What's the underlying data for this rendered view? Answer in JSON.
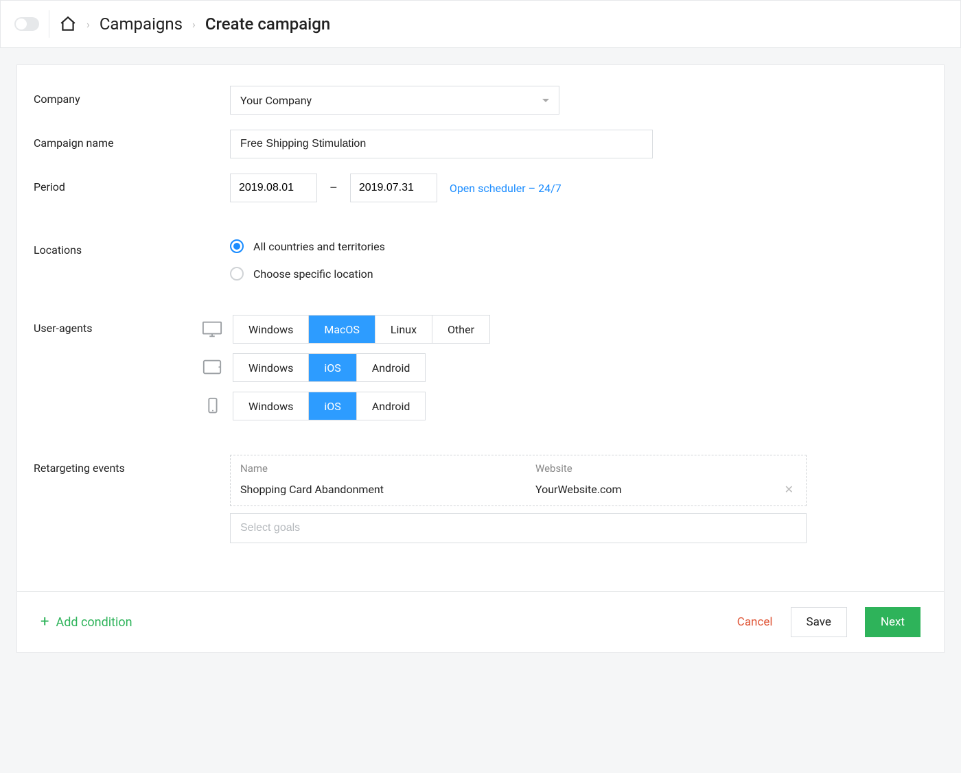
{
  "breadcrumb": {
    "campaigns": "Campaigns",
    "create": "Create campaign"
  },
  "labels": {
    "company": "Company",
    "campaign_name": "Campaign name",
    "period": "Period",
    "locations": "Locations",
    "user_agents": "User-agents",
    "retargeting": "Retargeting events"
  },
  "company": {
    "selected": "Your Company"
  },
  "campaign_name": "Free Shipping Stimulation",
  "period": {
    "from": "2019.08.01",
    "to": "2019.07.31",
    "dash": "–",
    "scheduler_link": "Open scheduler – 24/7"
  },
  "locations": {
    "all": "All countries and territories",
    "specific": "Choose specific location",
    "selected": "all"
  },
  "user_agents": {
    "desktop": {
      "windows": "Windows",
      "macos": "MacOS",
      "linux": "Linux",
      "other": "Other",
      "active": "macos"
    },
    "tablet": {
      "windows": "Windows",
      "ios": "iOS",
      "android": "Android",
      "active": "ios"
    },
    "phone": {
      "windows": "Windows",
      "ios": "iOS",
      "android": "Android",
      "active": "ios"
    }
  },
  "retargeting": {
    "header_name": "Name",
    "header_website": "Website",
    "row_name": "Shopping Card Abandonment",
    "row_website": "YourWebsite.com",
    "goals_placeholder": "Select goals"
  },
  "footer": {
    "add_condition": "Add condition",
    "cancel": "Cancel",
    "save": "Save",
    "next": "Next"
  }
}
